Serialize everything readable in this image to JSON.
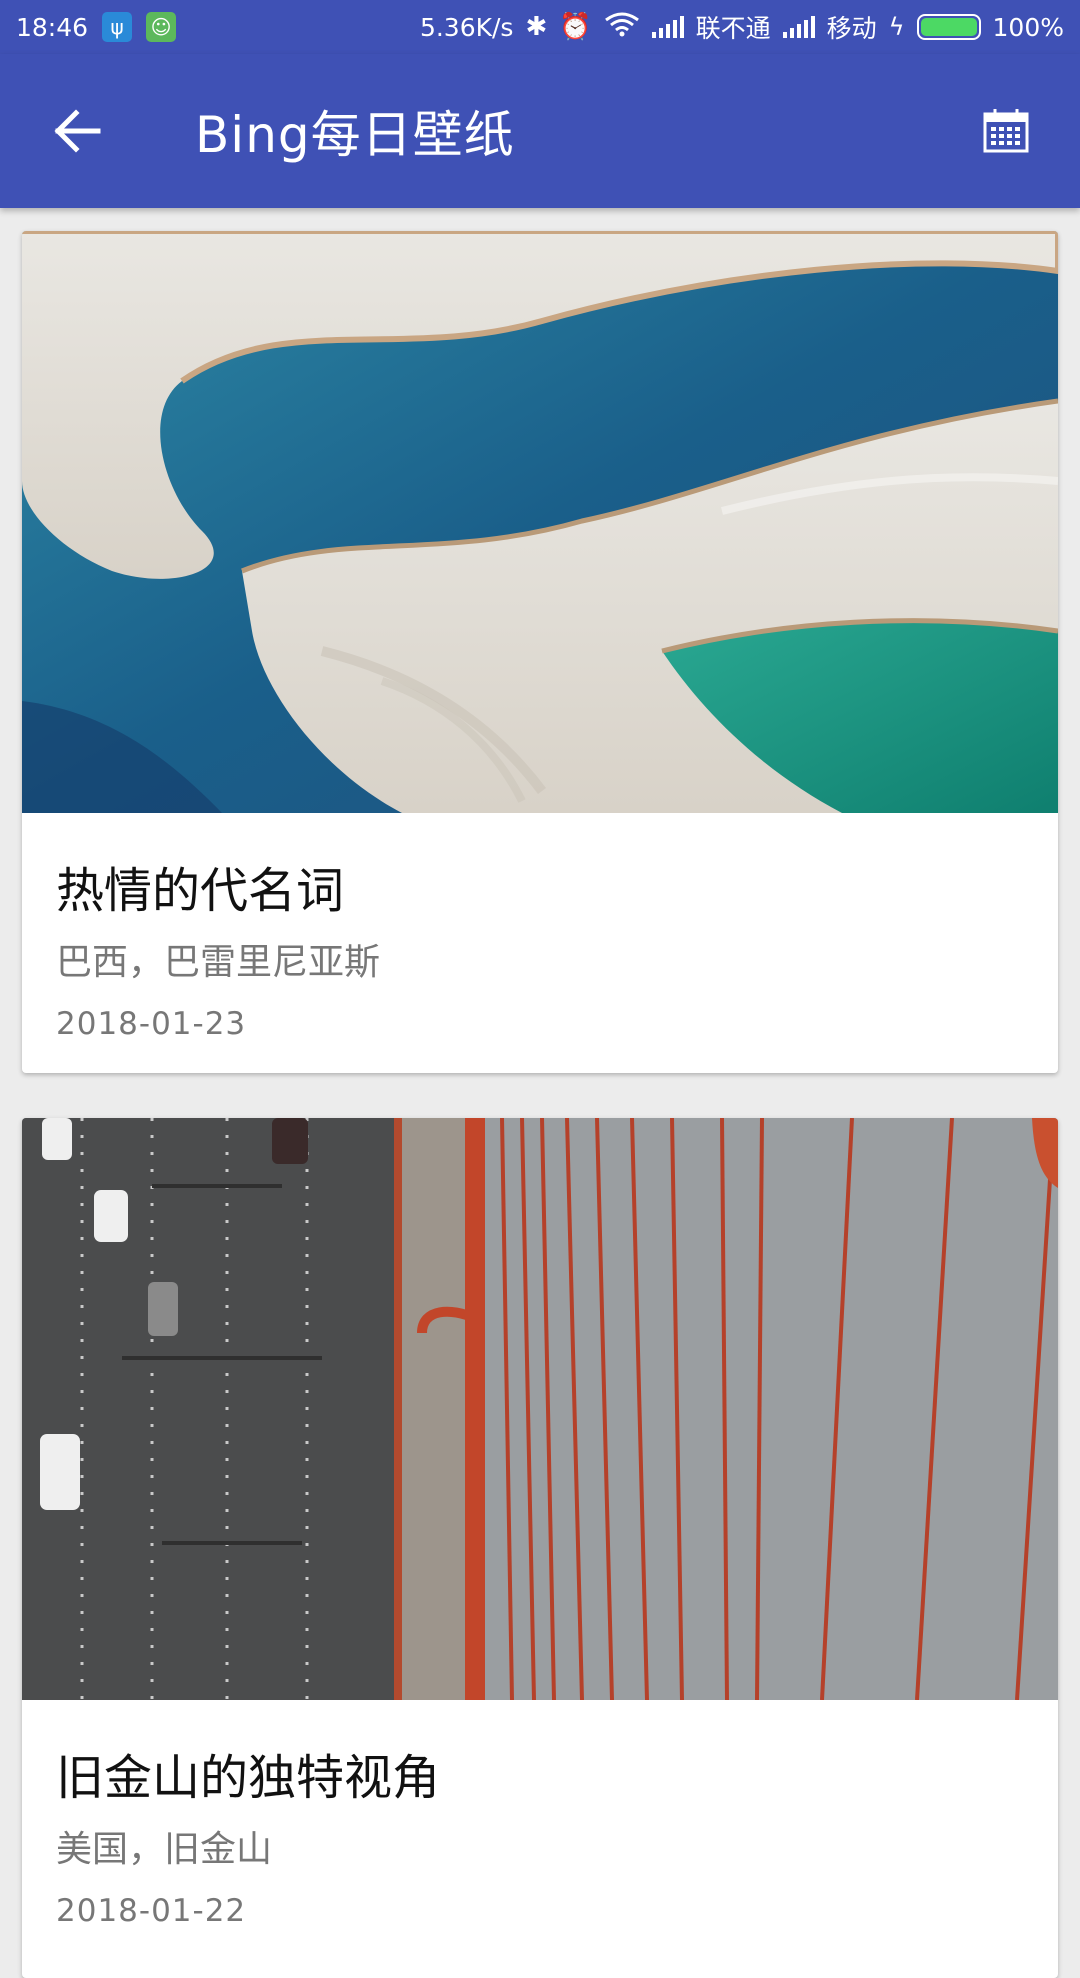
{
  "status_bar": {
    "time": "18:46",
    "net_speed": "5.36K/s",
    "carrier1": "联不通",
    "carrier2": "移动",
    "battery": "100%",
    "battery_level": 1.0
  },
  "app_bar": {
    "title": "Bing每日壁纸",
    "background": "#3f51b5"
  },
  "cards": [
    {
      "title": "热情的代名词",
      "location": "巴西，巴雷里尼亚斯",
      "date": "2018-01-23"
    },
    {
      "title": "旧金山的独特视角",
      "location": "美国，旧金山",
      "date": "2018-01-22"
    }
  ]
}
